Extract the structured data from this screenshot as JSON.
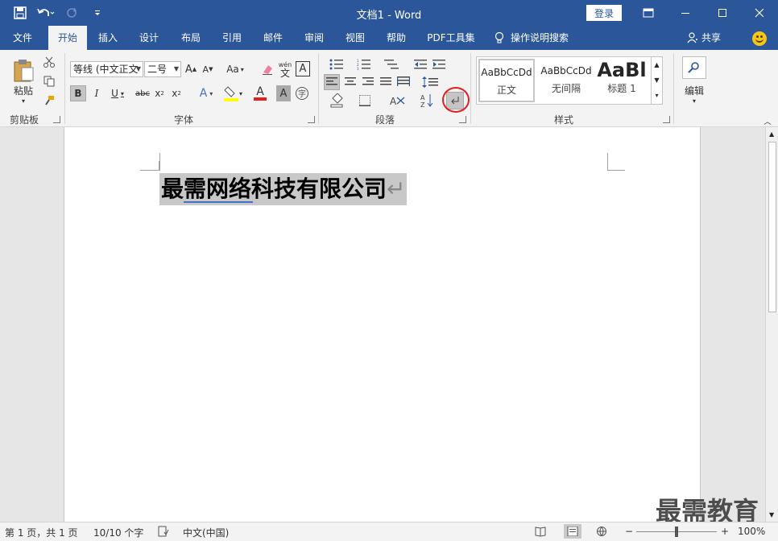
{
  "title_bar": {
    "doc_title": "文档1  -  Word",
    "login_label": "登录"
  },
  "tabs": [
    "文件",
    "开始",
    "插入",
    "设计",
    "布局",
    "引用",
    "邮件",
    "审阅",
    "视图",
    "帮助",
    "PDF工具集"
  ],
  "tell_me": "操作说明搜索",
  "share_label": "共享",
  "ribbon": {
    "clipboard": {
      "paste_label": "粘贴",
      "group_label": "剪贴板"
    },
    "font": {
      "font_name": "等线 (中文正文",
      "font_size": "二号",
      "case_label": "Aa",
      "phonetic_label": "wén",
      "strike_label": "abc",
      "group_label": "字体"
    },
    "paragraph": {
      "group_label": "段落"
    },
    "styles": {
      "items": [
        {
          "sample": "AaBbCcDd",
          "name": "正文"
        },
        {
          "sample": "AaBbCcDd",
          "name": "无间隔"
        },
        {
          "sample": "AaBl",
          "name": "标题 1"
        }
      ],
      "group_label": "样式"
    },
    "editing": {
      "label": "编辑"
    }
  },
  "document": {
    "heading": "最需网络科技有限公司",
    "para_mark": "↵"
  },
  "status": {
    "page": "第 1 页，共 1 页",
    "words": "10/10 个字",
    "language": "中文(中国)",
    "zoom": "100%",
    "zoom_level": 1.0
  },
  "watermark": "最需教育",
  "colors": {
    "brand": "#2b579a",
    "selection": "#c8c8c8",
    "annotation": "#e02020"
  }
}
